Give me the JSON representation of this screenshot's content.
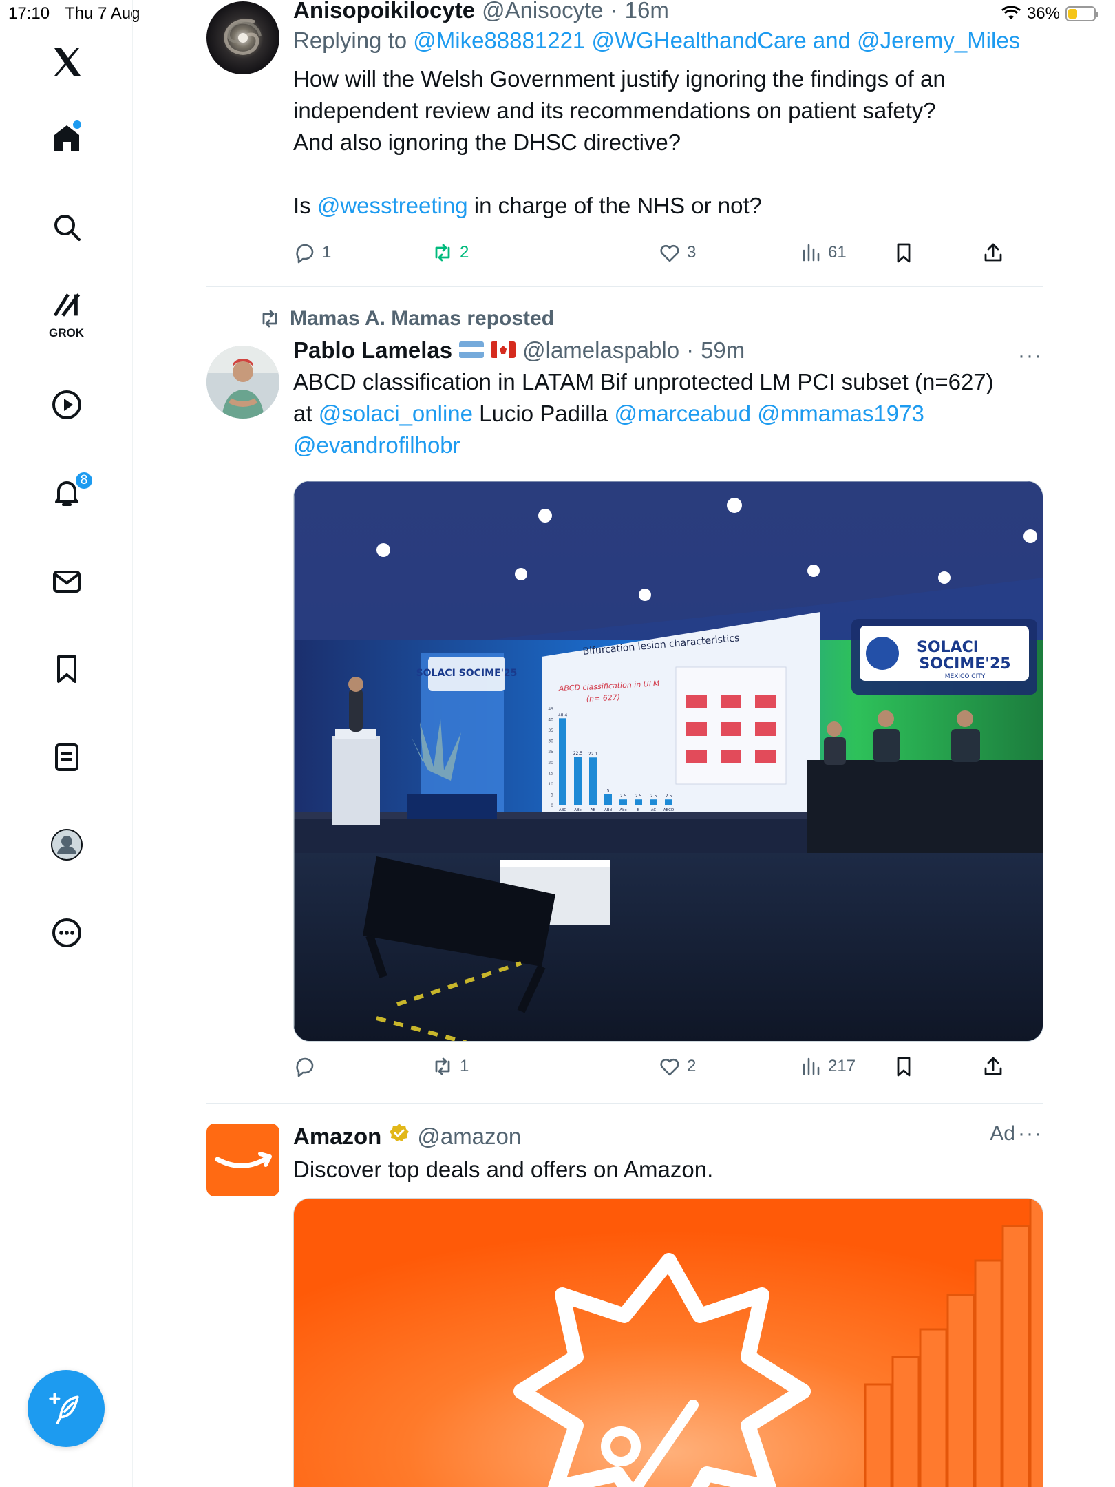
{
  "status_bar": {
    "time": "17:10",
    "date": "Thu 7 Aug",
    "battery": "36%"
  },
  "sidebar": {
    "items": [
      {
        "icon": "x-logo-icon"
      },
      {
        "icon": "home-icon"
      },
      {
        "icon": "search-icon"
      },
      {
        "icon": "grok-icon",
        "label": "GROK"
      },
      {
        "icon": "video-icon"
      },
      {
        "icon": "bell-icon",
        "badge": "8"
      },
      {
        "icon": "mail-icon"
      },
      {
        "icon": "bookmark-icon"
      },
      {
        "icon": "lists-icon"
      },
      {
        "icon": "profile-icon"
      },
      {
        "icon": "more-icon"
      }
    ]
  },
  "tweets": [
    {
      "display_name": "Anisopoikilocyte",
      "handle": "@Anisocyte",
      "time": "16m",
      "reply_prefix": "Replying to",
      "reply_mentions": "@Mike88881221 @WGHealthandCare",
      "reply_and": "and",
      "reply_last": "@Jeremy_Miles",
      "body_line1": "How will the Welsh Government justify ignoring the findings of an",
      "body_line2": "independent review and its recommendations on patient safety?",
      "body_line3": "And also ignoring the DHSC directive?",
      "body_p2_a": "Is",
      "body_p2_mention": "@wesstreeting",
      "body_p2_b": "in charge of the NHS or not?",
      "replies": "1",
      "reposts": "2",
      "likes": "3",
      "views": "61"
    },
    {
      "repost_by": "Mamas A. Mamas reposted",
      "display_name": "Pablo Lamelas",
      "handle": "@lamelaspablo",
      "time": "59m",
      "body_a": "ABCD classification in LATAM Bif unprotected LM PCI subset (n=627)",
      "body_b_prefix": "at",
      "body_b_m1": "@solaci_online",
      "body_b_text": "Lucio Padilla",
      "body_b_m2": "@marceabud",
      "body_b_m3": "@mmamas1973",
      "body_c_m1": "@evandrofilhobr",
      "slide": {
        "brand_line1": "SOLACI",
        "brand_line2": "SOCIME'25",
        "brand_city": "MEXICO CITY",
        "slide_title": "Bifurcation lesion characteristics",
        "chart_title_line1": "ABCD classification in ULM",
        "chart_title_line2": "(n= 627)"
      },
      "chart_data": {
        "type": "bar",
        "title": "ABCD classification in ULM (n= 627)",
        "categories": [
          "ABC",
          "ABc",
          "AB",
          "ABd",
          "Abc",
          "B",
          "AC",
          "ABCD"
        ],
        "values": [
          40.4,
          22.5,
          22.1,
          5,
          2.5,
          2.5,
          2.5,
          2.5
        ],
        "ylim": [
          0,
          45
        ],
        "yticks": [
          0,
          5,
          10,
          15,
          20,
          25,
          30,
          35,
          40,
          45
        ]
      },
      "replies": "",
      "reposts": "1",
      "likes": "2",
      "views": "217"
    },
    {
      "display_name": "Amazon",
      "handle": "@amazon",
      "ad_label": "Ad",
      "body": "Discover top deals and offers on Amazon."
    }
  ],
  "colors": {
    "accent": "#1d9bf0",
    "repost_green": "#00ba7c",
    "amazon_orange": "#ff6a13"
  }
}
